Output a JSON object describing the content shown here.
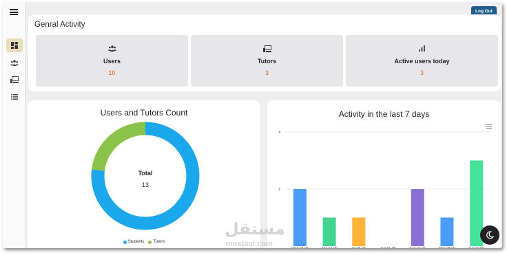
{
  "header": {
    "logout_label": "Log Out"
  },
  "sidebar": {
    "items": [
      {
        "icon": "dashboard-icon",
        "active": true
      },
      {
        "icon": "users-icon",
        "active": false
      },
      {
        "icon": "tutors-icon",
        "active": false
      },
      {
        "icon": "list-icon",
        "active": false
      }
    ]
  },
  "general": {
    "title": "Genral Activity",
    "stats": [
      {
        "icon": "users-icon",
        "label": "Users",
        "value": "10"
      },
      {
        "icon": "tutors-icon",
        "label": "Tutors",
        "value": "3"
      },
      {
        "icon": "bar-chart-icon",
        "label": "Active users today",
        "value": "3"
      }
    ]
  },
  "donut_card": {
    "title": "Users and Tutors Count",
    "center_label": "Total",
    "center_value": "13"
  },
  "bar_card": {
    "title": "Activity in the last 7 days"
  },
  "watermark": {
    "arabic": "مستقل",
    "latin": "mostaql.com"
  },
  "colors": {
    "accent": "#1f5a8a",
    "stat_value": "#d2691e",
    "students": "#1aa7ec",
    "tutors": "#8bc34a"
  },
  "chart_data": [
    {
      "type": "pie",
      "title": "Users and Tutors Count",
      "categories": [
        "Students",
        "Tutors"
      ],
      "values": [
        10,
        3
      ],
      "colors": [
        "#1aa7ec",
        "#8bc34a"
      ],
      "legend": "bottom"
    },
    {
      "type": "bar",
      "title": "Activity in the last 7 days",
      "categories": [
        "Wed 03-05",
        "Thu 04-05",
        "Fri 05-05",
        "Sat 06-05",
        "Sun 07-05",
        "Mon 08-05",
        "Tue 09-05"
      ],
      "values": [
        2,
        1,
        1,
        0,
        2,
        1,
        3
      ],
      "colors": [
        "#4a9cf7",
        "#44d492",
        "#fbb33a",
        "#f4625a",
        "#8a6fd4",
        "#4a9cf7",
        "#44e399"
      ],
      "yticks": [
        2,
        4
      ],
      "ylim": [
        0,
        4
      ],
      "grid": true
    }
  ]
}
